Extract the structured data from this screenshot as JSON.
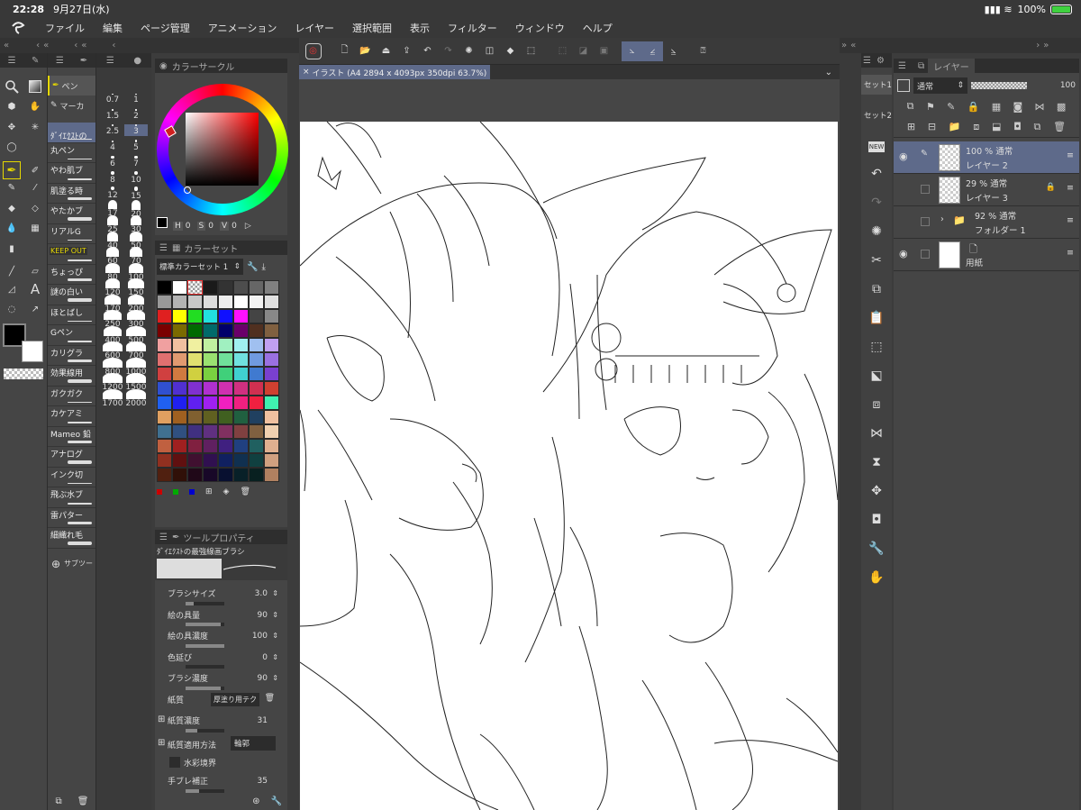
{
  "status": {
    "time": "22:28",
    "date": "9月27日(水)",
    "battery": "100%"
  },
  "menu": [
    "ファイル",
    "編集",
    "ページ管理",
    "アニメーション",
    "レイヤー",
    "選択範囲",
    "表示",
    "フィルター",
    "ウィンドウ",
    "ヘルプ"
  ],
  "subtools": {
    "pen_tab": "ペン",
    "marker_tab": "マーカ",
    "selected": "ﾀﾞｲｴｸｽﾄの",
    "items": [
      "丸ペン",
      "やわ肌ブ",
      "肌塗る時",
      "やたかブ",
      "リアルG",
      "KEEP OUT",
      "ちょっぴ",
      "謎の白い",
      "ほとばし",
      "Gペン",
      "カリグラ",
      "効果線用",
      "ガクガク",
      "カケアミ",
      "Mameo 鉛",
      "アナログ",
      "インク切",
      "飛ぶ水ブ",
      "雷パター",
      "細織れ毛"
    ],
    "add_label": "サブツー"
  },
  "sizes": [
    [
      "0.7",
      "1"
    ],
    [
      "1.5",
      "2"
    ],
    [
      "2.5",
      "3"
    ],
    [
      "4",
      "5"
    ],
    [
      "6",
      "7"
    ],
    [
      "8",
      "10"
    ],
    [
      "12",
      "15"
    ],
    [
      "17",
      "20"
    ],
    [
      "25",
      "30"
    ],
    [
      "40",
      "50"
    ],
    [
      "60",
      "70"
    ],
    [
      "80",
      "100"
    ],
    [
      "120",
      "150"
    ],
    [
      "170",
      "200"
    ],
    [
      "250",
      "300"
    ],
    [
      "400",
      "500"
    ],
    [
      "600",
      "700"
    ],
    [
      "800",
      "1000"
    ],
    [
      "1200",
      "1500"
    ],
    [
      "1700",
      "2000"
    ]
  ],
  "color_circle": {
    "title": "カラーサークル",
    "h": "H",
    "h_val": "0",
    "s": "S",
    "s_val": "0",
    "v": "V",
    "v_val": "0"
  },
  "color_set": {
    "title": "カラーセット",
    "selected": "標準カラーセット 1",
    "rows": [
      [
        "#000000",
        "#ffffff",
        "#cccccc",
        "#1a1a1a",
        "#333333",
        "#4d4d4d",
        "#666666",
        "#808080"
      ],
      [
        "#999999",
        "#b3b3b3",
        "#c8c8c8",
        "#dddddd",
        "#eeeeee",
        "#ffffff",
        "#f2f2f2",
        "#e0e0e0"
      ],
      [
        "#e02020",
        "#ffff00",
        "#22dd22",
        "#22e0e0",
        "#1010ff",
        "#ff10ff",
        "#444444",
        "#888888"
      ],
      [
        "#7a0000",
        "#7a6a00",
        "#006a00",
        "#006a6a",
        "#00006a",
        "#6a006a",
        "#503020",
        "#806040"
      ],
      [
        "#f0a0a0",
        "#f0c0a0",
        "#f0f0a0",
        "#c0f0a0",
        "#a0f0c0",
        "#a0f0f0",
        "#a0c0f0",
        "#c0a0f0"
      ],
      [
        "#e07070",
        "#e09a70",
        "#e0e070",
        "#9ae070",
        "#70e09a",
        "#70e0e0",
        "#709ae0",
        "#9a70e0"
      ],
      [
        "#d04040",
        "#d07a40",
        "#d0d040",
        "#7ad040",
        "#40d07a",
        "#40d0d0",
        "#407ad0",
        "#7a40d0"
      ],
      [
        "#3050d0",
        "#5030d0",
        "#8030d0",
        "#b030d0",
        "#d030b0",
        "#d03080",
        "#d03050",
        "#d04030"
      ],
      [
        "#2060f0",
        "#2020f0",
        "#6020f0",
        "#a020f0",
        "#f020c0",
        "#f02080",
        "#f02040",
        "#40f0b0"
      ],
      [
        "#e0a060",
        "#a06020",
        "#806030",
        "#606020",
        "#406020",
        "#206040",
        "#204060",
        "#f0c0a0"
      ],
      [
        "#407090",
        "#305080",
        "#403080",
        "#603080",
        "#803060",
        "#804040",
        "#806040",
        "#f0d0b0"
      ],
      [
        "#c06040",
        "#a02020",
        "#802040",
        "#602060",
        "#402080",
        "#204080",
        "#206060",
        "#e0b090"
      ],
      [
        "#903020",
        "#601010",
        "#401030",
        "#301050",
        "#102060",
        "#103050",
        "#104040",
        "#d0a080"
      ],
      [
        "#502010",
        "#301008",
        "#200818",
        "#180828",
        "#081030",
        "#082028",
        "#082020",
        "#b08060"
      ]
    ]
  },
  "tool_property": {
    "title": "ツールプロパティ",
    "brush_name": "ﾀﾞｲｴｸｽﾄの最強線画ブラシ",
    "items": [
      {
        "label": "ブラシサイズ",
        "value": "3.0",
        "level": 0.2
      },
      {
        "label": "絵の具量",
        "value": "90",
        "level": 0.9
      },
      {
        "label": "絵の具濃度",
        "value": "100",
        "level": 1
      },
      {
        "label": "色延び",
        "value": "0",
        "level": 0
      },
      {
        "label": "ブラシ濃度",
        "value": "90",
        "level": 0.9
      }
    ],
    "paper": "紙質",
    "paper_value": "厚塗り用テク",
    "paper_density": "紙質濃度",
    "paper_density_value": "31",
    "paper_method": "紙質適用方法",
    "paper_method_value": "輪郭",
    "watercolor": "水彩境界",
    "stabilization": "手ブレ補正",
    "stabilization_value": "35"
  },
  "canvas_tab": "イラスト (A4 2894 x 4093px 350dpi 63.7%)",
  "layer_panel": {
    "title": "レイヤー",
    "blend": "通常",
    "opacity": "100",
    "set_tabs": [
      "セット1",
      "セット2"
    ],
    "layers": [
      {
        "opacity": "100 % 通常",
        "name": "レイヤー 2",
        "selected": true
      },
      {
        "opacity": "29 % 通常",
        "name": "レイヤー 3",
        "selected": false
      },
      {
        "opacity": "92 % 通常",
        "name": "フォルダー 1",
        "selected": false
      },
      {
        "opacity": "",
        "name": "用紙",
        "selected": false
      }
    ]
  },
  "colors": {
    "accent": "#e6d800",
    "selected_bg": "#5e6a8a",
    "panel": "#454545",
    "canvas": "#ffffff"
  }
}
